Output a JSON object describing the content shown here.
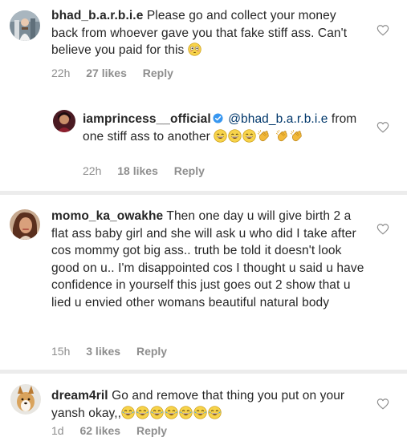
{
  "comments": [
    {
      "username": "bhad_b.a.r.b.i.e",
      "text": "Please go and collect your money back from whoever gave you that fake stiff ass. Can't believe you paid for this",
      "time": "22h",
      "likes": "27 likes",
      "reply": "Reply"
    },
    {
      "username": "iamprincess__official",
      "mention": "@bhad_b.a.r.b.i.e",
      "text": "from one stiff ass to another",
      "time": "22h",
      "likes": "18 likes",
      "reply": "Reply"
    },
    {
      "username": "momo_ka_owakhe",
      "text": "Then one day u will give birth 2  a flat ass baby girl and she will ask u who did I take after cos mommy got big ass.. truth be told it doesn't look good on u.. I'm disappointed cos I thought u said u have confidence in yourself this just goes out 2 show that u lied u envied other womans beautiful natural body",
      "time": "15h",
      "likes": "3 likes",
      "reply": "Reply"
    },
    {
      "username": "dream4ril",
      "text": "Go and remove that thing you put on your yansh okay,,",
      "time": "1d",
      "likes": "62 likes",
      "reply": "Reply"
    }
  ],
  "icons": {
    "like": "heart-outline-icon",
    "verified": "verified-badge-icon",
    "emoji_flushed": "flushed-face-emoji",
    "emoji_grin": "grinning-face-emoji",
    "emoji_clap": "clapping-hands-emoji",
    "emoji_joy": "tears-of-joy-emoji"
  },
  "colors": {
    "text": "#262626",
    "meta": "#8e8e8e",
    "mention": "#00376b",
    "verified": "#3897f0",
    "divider": "#ececec"
  }
}
